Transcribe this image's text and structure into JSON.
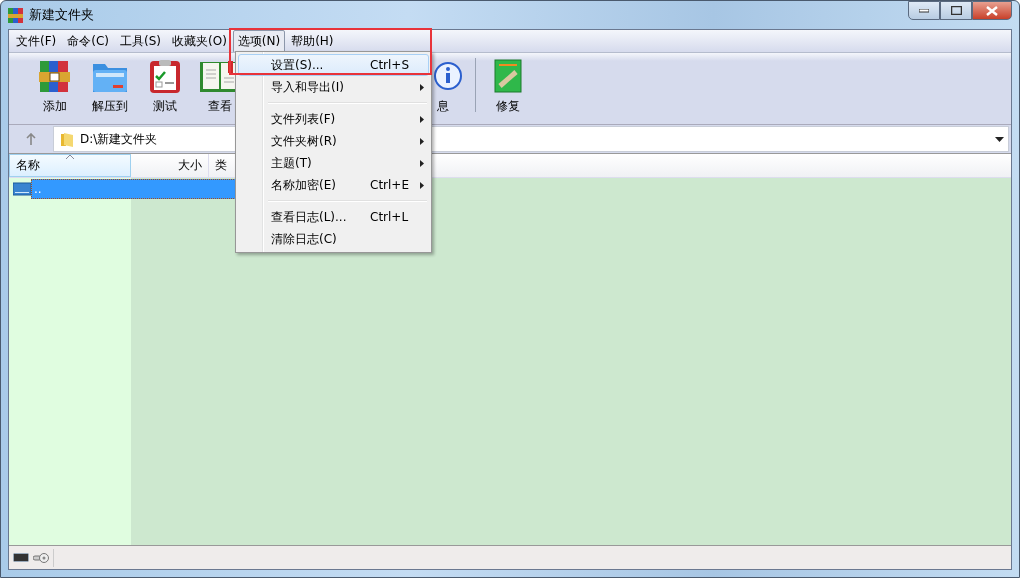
{
  "window": {
    "title": "新建文件夹"
  },
  "menu_bar": [
    {
      "label": "文件(F)",
      "selected": false
    },
    {
      "label": "命令(C)",
      "selected": false
    },
    {
      "label": "工具(S)",
      "selected": false
    },
    {
      "label": "收藏夹(O)",
      "selected": false
    },
    {
      "label": "选项(N)",
      "selected": true
    },
    {
      "label": "帮助(H)",
      "selected": false
    }
  ],
  "toolbar": [
    {
      "kind": "add",
      "label": "添加"
    },
    {
      "kind": "extract",
      "label": "解压到"
    },
    {
      "kind": "test",
      "label": "测试"
    },
    {
      "kind": "view",
      "label": "查看"
    },
    {
      "kind": "info",
      "label": "息"
    },
    {
      "kind": "repair",
      "label": "修复"
    }
  ],
  "address_bar": {
    "path": "D:\\新建文件夹"
  },
  "file_list": {
    "columns": [
      "名称",
      "大小",
      "类"
    ],
    "rows": [
      {
        "name": "..",
        "selected": true
      }
    ]
  },
  "options_menu": [
    {
      "kind": "item",
      "label": "设置(S)...",
      "shortcut": "Ctrl+S",
      "submenu": false,
      "selected": true
    },
    {
      "kind": "item",
      "label": "导入和导出(I)",
      "submenu": true,
      "selected": false
    },
    {
      "kind": "separator"
    },
    {
      "kind": "item",
      "label": "文件列表(F)",
      "submenu": true,
      "selected": false
    },
    {
      "kind": "item",
      "label": "文件夹树(R)",
      "submenu": true,
      "selected": false
    },
    {
      "kind": "item",
      "label": "主题(T)",
      "submenu": true,
      "selected": false
    },
    {
      "kind": "item",
      "label": "名称加密(E)",
      "shortcut": "Ctrl+E",
      "submenu": true,
      "selected": false
    },
    {
      "kind": "separator"
    },
    {
      "kind": "item",
      "label": "查看日志(L)...",
      "shortcut": "Ctrl+L",
      "submenu": false,
      "selected": false
    },
    {
      "kind": "item",
      "label": "清除日志(C)",
      "submenu": false,
      "selected": false
    }
  ]
}
